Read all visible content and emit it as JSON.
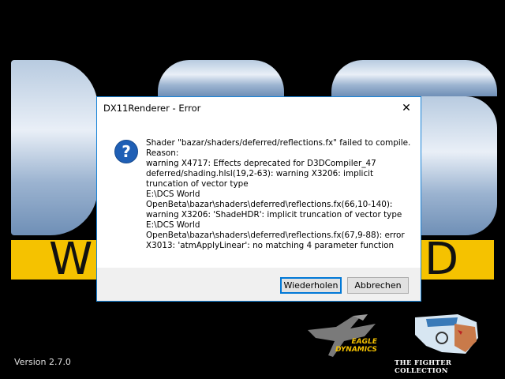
{
  "dialog": {
    "title": "DX11Renderer - Error",
    "close_glyph": "✕",
    "icon_glyph": "?",
    "message": "Shader \"bazar/shaders/deferred/reflections.fx\" failed to compile. Reason:\nwarning X4717: Effects deprecated for D3DCompiler_47\ndeferred/shading.hlsl(19,2-63): warning X3206: implicit truncation of vector type\nE:\\DCS World OpenBeta\\bazar\\shaders\\deferred\\reflections.fx(66,10-140): warning X3206: 'ShadeHDR': implicit truncation of vector type\nE:\\DCS World OpenBeta\\bazar\\shaders\\deferred\\reflections.fx(67,9-88): error X3013: 'atmApplyLinear': no matching 4 parameter function",
    "buttons": {
      "retry": "Wiederholen",
      "cancel": "Abbrechen"
    }
  },
  "splash": {
    "band_letter_left": "W",
    "band_letter_right": "D",
    "version": "Version 2.7.0",
    "eagle_dynamics": "EAGLE\nDYNAMICS",
    "fighter_collection": "THE FIGHTER COLLECTION"
  },
  "colors": {
    "accent": "#1883d7",
    "band": "#f5c200",
    "icon": "#1f5fb5"
  },
  "icons": {
    "dialog_icon": "question-icon",
    "close": "close-icon"
  }
}
